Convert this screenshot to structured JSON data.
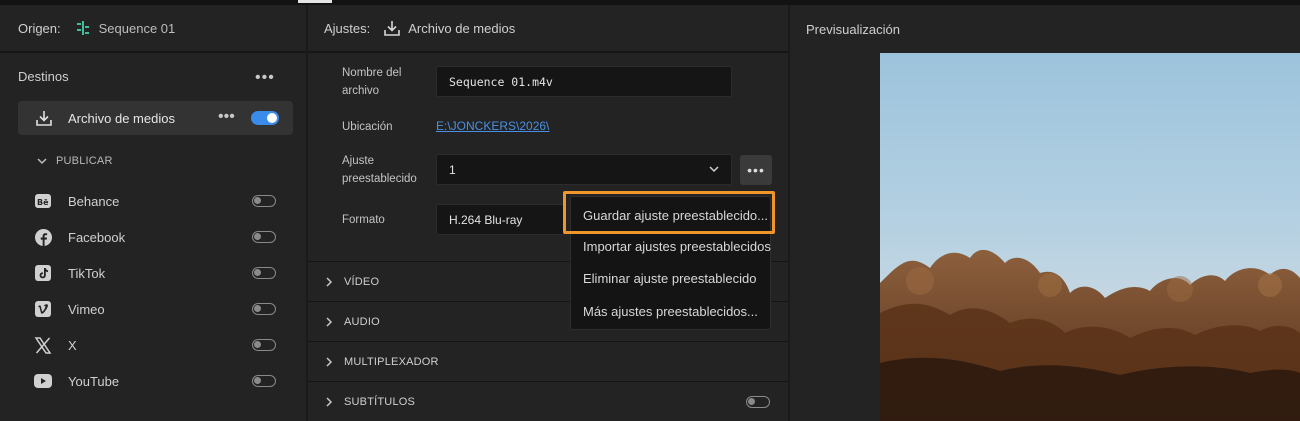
{
  "source": {
    "label": "Origen:",
    "sequence": "Sequence 01"
  },
  "destinations": {
    "title": "Destinos",
    "media_file": {
      "label": "Archivo de medios",
      "enabled": true
    },
    "publish_label": "PUBLICAR",
    "social": [
      {
        "name": "Behance",
        "icon": "behance-icon",
        "enabled": false
      },
      {
        "name": "Facebook",
        "icon": "facebook-icon",
        "enabled": false
      },
      {
        "name": "TikTok",
        "icon": "tiktok-icon",
        "enabled": false
      },
      {
        "name": "Vimeo",
        "icon": "vimeo-icon",
        "enabled": false
      },
      {
        "name": "X",
        "icon": "x-icon",
        "enabled": false
      },
      {
        "name": "YouTube",
        "icon": "youtube-icon",
        "enabled": false
      }
    ]
  },
  "settings": {
    "label": "Ajustes:",
    "target": "Archivo de medios",
    "filename_label": "Nombre del archivo",
    "filename_value": "Sequence 01.m4v",
    "location_label": "Ubicación",
    "location_value": "E:\\JONCKERS\\2026\\",
    "preset_label": "Ajuste preestablecido",
    "preset_value": "1",
    "format_label": "Formato",
    "format_value": "H.264 Blu-ray",
    "sections": [
      {
        "title": "VÍDEO"
      },
      {
        "title": "AUDIO"
      },
      {
        "title": "MULTIPLEXADOR"
      },
      {
        "title": "SUBTÍTULOS",
        "toggle": false
      }
    ]
  },
  "preset_menu": {
    "items": [
      "Guardar ajuste preestablecido...",
      "Importar ajustes preestablecidos",
      "Eliminar ajuste preestablecido",
      "Más ajustes preestablecidos..."
    ],
    "highlighted_index": 0,
    "highlight_color": "#f0952a"
  },
  "preview": {
    "title": "Previsualización"
  },
  "colors": {
    "accent": "#3b8bea",
    "link": "#4a90e2",
    "panel": "#232323"
  }
}
